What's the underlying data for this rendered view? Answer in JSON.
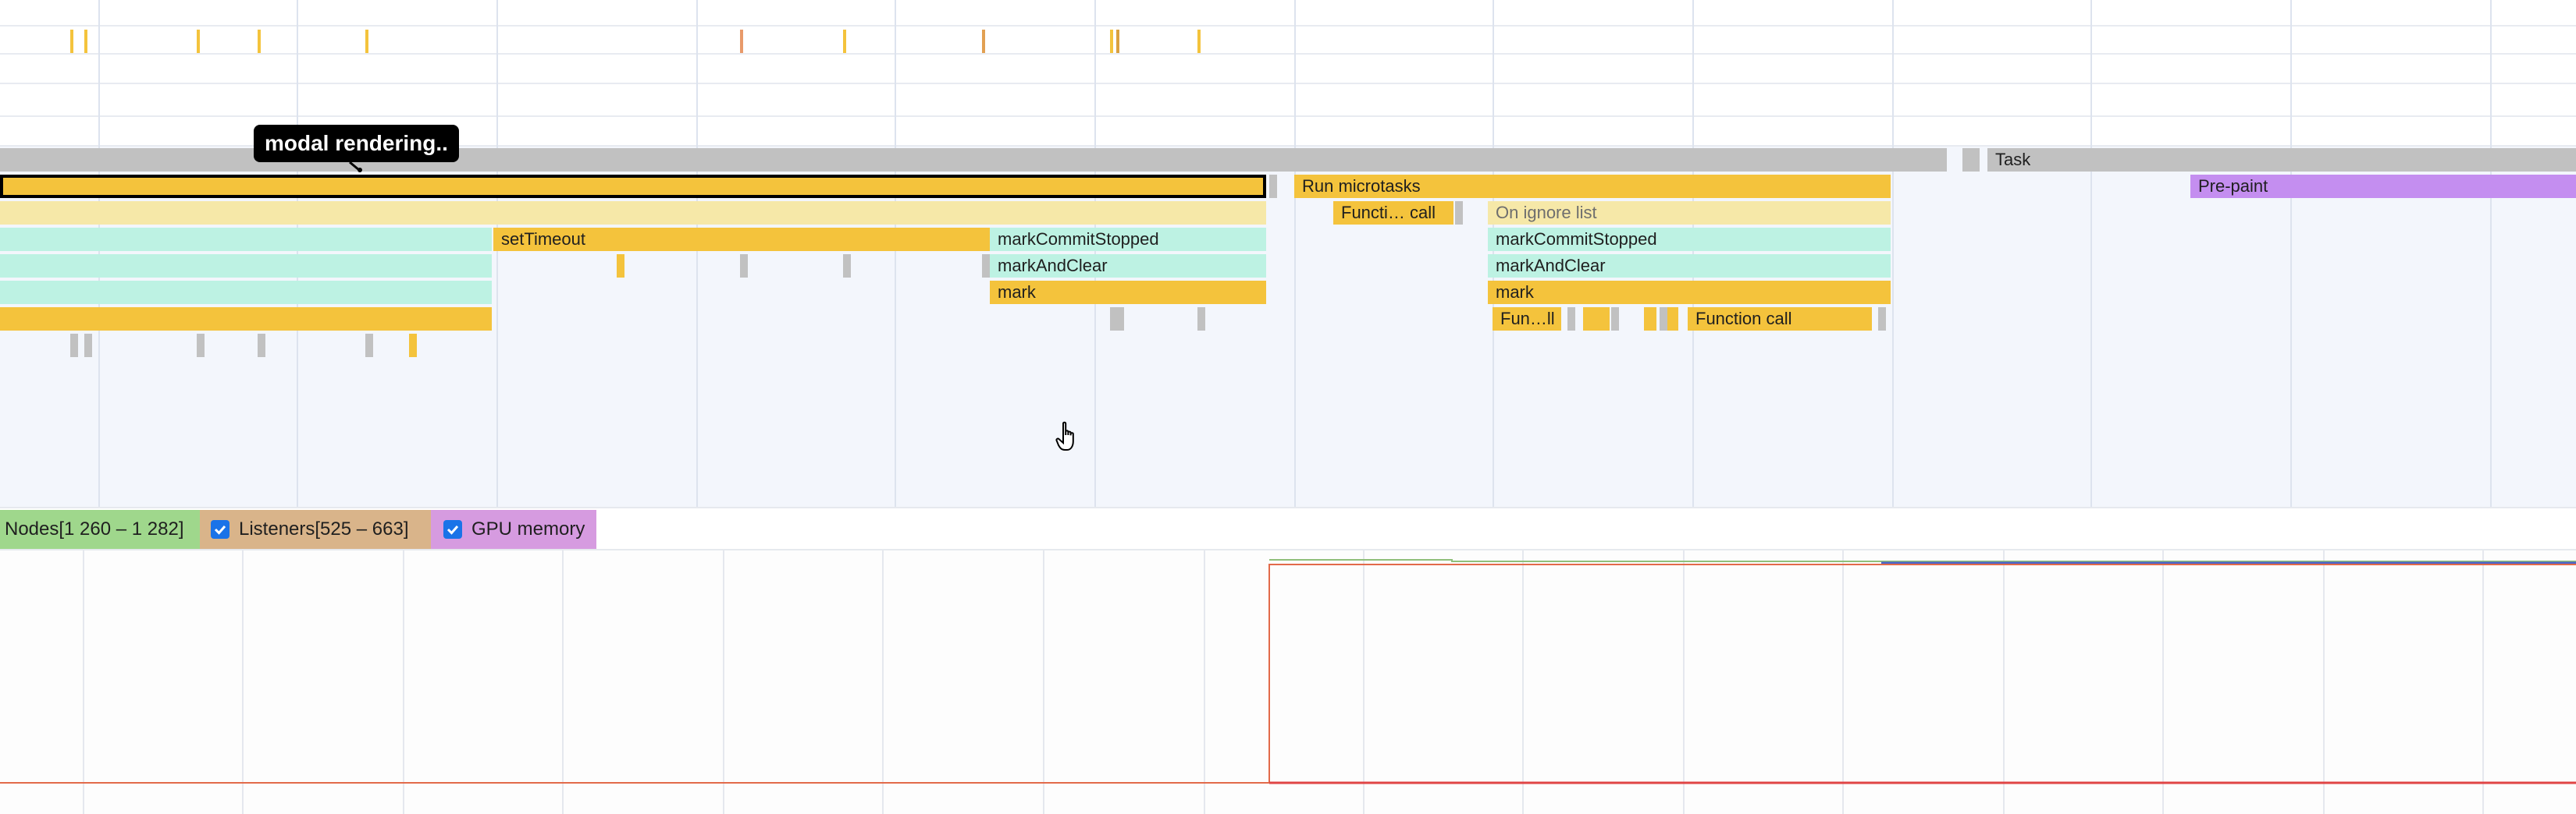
{
  "tooltip": {
    "text": "modal rendering.."
  },
  "flame": {
    "task_label": "Task",
    "run_microtasks_label": "Run microtasks",
    "pre_paint_label": "Pre-paint",
    "function_call_short_label": "Functi… call",
    "on_ignore_list_label": "On ignore list",
    "set_timeout_label": "setTimeout",
    "mark_commit_stopped_label": "markCommitStopped",
    "mark_and_clear_label": "markAndClear",
    "mark_label": "mark",
    "fun_ll_label": "Fun…ll",
    "function_call_label": "Function call"
  },
  "legend": {
    "nodes_label": "Nodes[1 260 – 1 282]",
    "listeners_label": "Listeners[525 – 663]",
    "gpu_memory_label": "GPU memory",
    "listeners_checked": true,
    "gpu_memory_checked": true
  },
  "colors": {
    "scripting": "#f4c33c",
    "ignore_list": "#f6e8a8",
    "user_timing": "#bdf2e3",
    "task": "#c1c1c1",
    "painting": "#c48ef0",
    "nodes_legend": "#9fd78c",
    "listeners_legend": "#d9b48a",
    "gpu_legend": "#d69be0",
    "checkbox": "#1a73e8"
  },
  "icons": {
    "cursor": "hand-pointer-icon",
    "checkbox": "checkmark-icon"
  }
}
